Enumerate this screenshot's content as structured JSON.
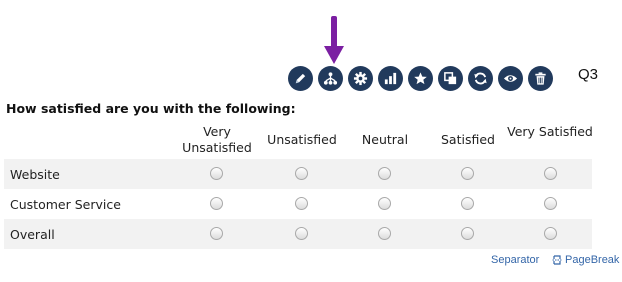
{
  "toolbar": {
    "icons": [
      "pencil-icon",
      "branch-icon",
      "gear-icon",
      "bar-chart-icon",
      "star-icon",
      "copy-icon",
      "refresh-icon",
      "eye-icon",
      "trash-icon"
    ],
    "accent": "#213a5c",
    "arrow_color": "#7b1fa2"
  },
  "question": {
    "number": "Q3",
    "title": "How satisfied are you with the following:"
  },
  "columns": [
    "Very Unsatisfied",
    "Unsatisfied",
    "Neutral",
    "Satisfied",
    "Very Satisfied"
  ],
  "rows": [
    "Website",
    "Customer Service",
    "Overall"
  ],
  "links": {
    "separator": "Separator",
    "pagebreak": "PageBreak"
  }
}
